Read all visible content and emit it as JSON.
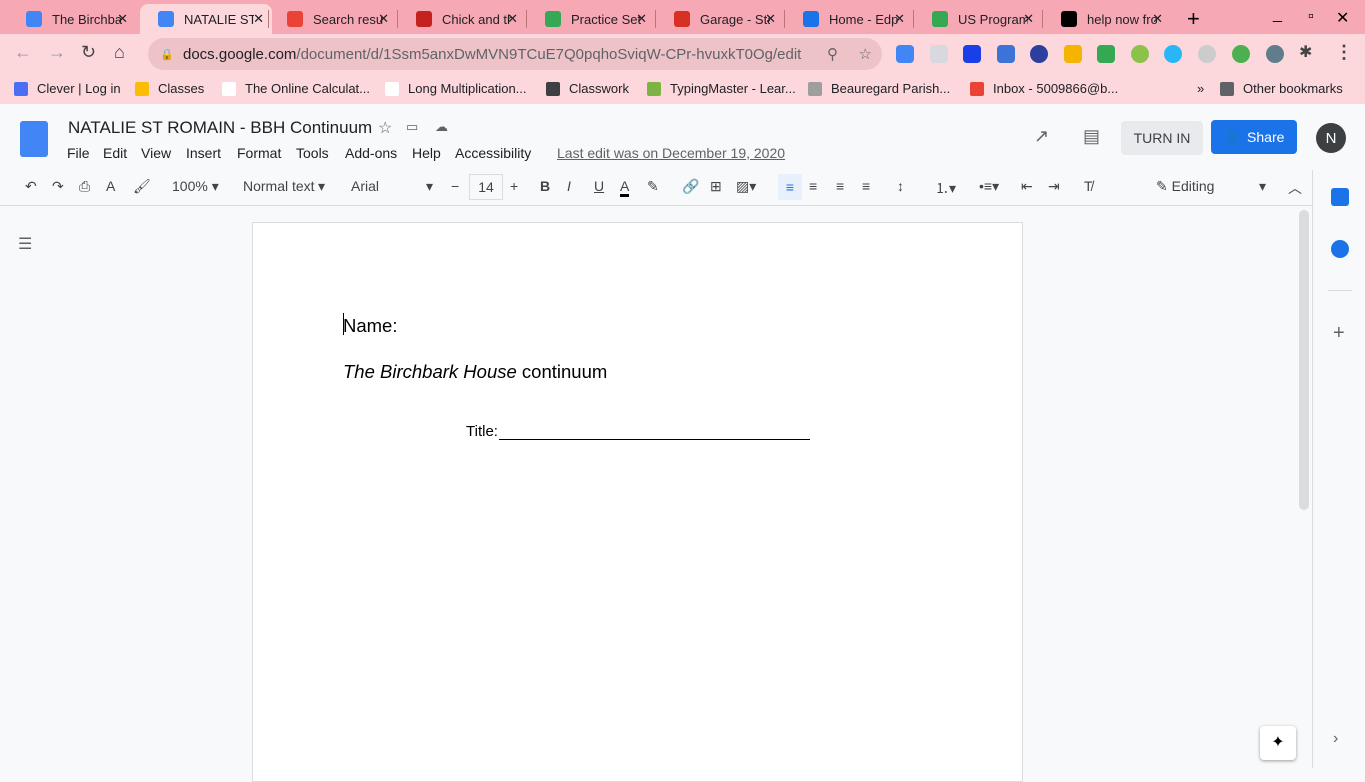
{
  "tabs": [
    {
      "title": "The Birchbark",
      "color": "#4285f4"
    },
    {
      "title": "NATALIE ST ROMAIN",
      "color": "#4285f4",
      "active": true
    },
    {
      "title": "Search results",
      "color": "#ea4335"
    },
    {
      "title": "Chick and the",
      "color": "#c5221f"
    },
    {
      "title": "Practice Set",
      "color": "#34a853"
    },
    {
      "title": "Garage - Start",
      "color": "#d93025"
    },
    {
      "title": "Home - Edpuzzle",
      "color": "#1a73e8"
    },
    {
      "title": "US Programs",
      "color": "#34a853"
    },
    {
      "title": "help now from",
      "color": "#000000"
    }
  ],
  "address": {
    "host": "docs.google.com",
    "path": "/document/d/1Ssm5anxDwMVN9TCuE7Q0pqhoSviqW-CPr-hvuxkT0Og/edit"
  },
  "bookmarks": [
    {
      "label": "Clever | Log in",
      "color": "#4c6ef5"
    },
    {
      "label": "Classes",
      "color": "#fbbc04"
    },
    {
      "label": "The Online Calculat...",
      "color": "#fff"
    },
    {
      "label": "Long Multiplication...",
      "color": "#fff"
    },
    {
      "label": "Classwork",
      "color": "#3c4043"
    },
    {
      "label": "TypingMaster - Lear...",
      "color": "#7cb342"
    },
    {
      "label": "Beauregard Parish...",
      "color": "#9e9e9e"
    },
    {
      "label": "Inbox - 5009866@b...",
      "color": "#ea4335"
    }
  ],
  "other_bookmarks": "Other bookmarks",
  "doc": {
    "title": "NATALIE ST ROMAIN - BBH Continuum",
    "menus": [
      "File",
      "Edit",
      "View",
      "Insert",
      "Format",
      "Tools",
      "Add-ons",
      "Help",
      "Accessibility"
    ],
    "last_edit": "Last edit was on December 19, 2020",
    "turn_in": "TURN IN",
    "share": "Share",
    "avatar": "N"
  },
  "format": {
    "zoom": "100%",
    "style": "Normal text",
    "font": "Arial",
    "size": "14",
    "mode": "Editing"
  },
  "content": {
    "name": "Name:",
    "italic": "The Birchbark House",
    "rest": " continuum",
    "title_label": "Title:"
  }
}
